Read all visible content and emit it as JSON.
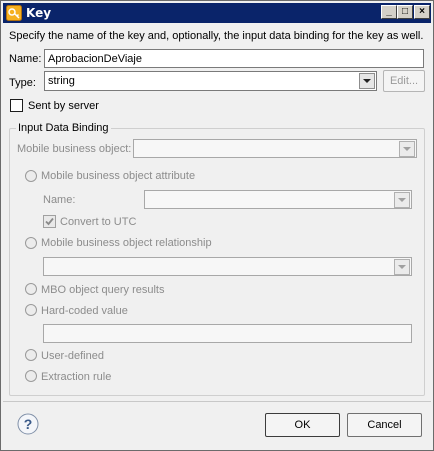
{
  "window": {
    "title": "Key",
    "icon": "key-app-icon",
    "controls": {
      "minimize": "_",
      "maximize": "□",
      "close": "×"
    }
  },
  "description": "Specify the name of the key and, optionally, the input data binding for the key as well.",
  "name_field": {
    "label": "Name:",
    "value": "AprobacionDeViaje"
  },
  "type_field": {
    "label": "Type:",
    "value": "string",
    "edit_button": "Edit..."
  },
  "sent_by_server": {
    "label": "Sent by server",
    "checked": false
  },
  "input_data_binding": {
    "group_label": "Input Data Binding",
    "mbo_label": "Mobile business object:",
    "mbo_value": "",
    "options": {
      "mbo_attribute": "Mobile business object attribute",
      "attr_name_label": "Name:",
      "attr_name_value": "",
      "convert_to_utc": "Convert to UTC",
      "mbo_relationship": "Mobile business object relationship",
      "relationship_value": "",
      "mbo_query_results": "MBO object query results",
      "hard_coded_value": "Hard-coded value",
      "hard_coded_text": "",
      "user_defined": "User-defined",
      "extraction_rule": "Extraction rule"
    }
  },
  "footer": {
    "help": "?",
    "ok": "OK",
    "cancel": "Cancel"
  }
}
